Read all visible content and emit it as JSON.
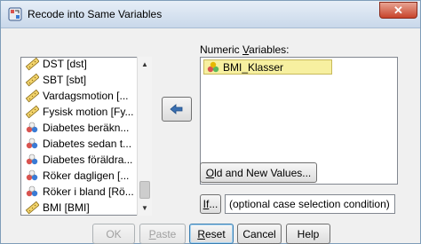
{
  "window": {
    "title": "Recode into Same Variables",
    "close_glyph": "✕"
  },
  "variable_list": {
    "items": [
      {
        "label": "DST [dst]",
        "icon": "scale-ruler-icon"
      },
      {
        "label": "SBT [sbt]",
        "icon": "scale-ruler-icon"
      },
      {
        "label": "Vardagsmotion [...",
        "icon": "scale-ruler-icon"
      },
      {
        "label": "Fysisk motion [Fy...",
        "icon": "scale-ruler-icon"
      },
      {
        "label": "Diabetes beräkn...",
        "icon": "nominal-circles-icon"
      },
      {
        "label": "Diabetes sedan t...",
        "icon": "nominal-circles-icon"
      },
      {
        "label": "Diabetes föräldra...",
        "icon": "nominal-circles-icon"
      },
      {
        "label": "Röker dagligen [...",
        "icon": "nominal-circles-icon"
      },
      {
        "label": "Röker i bland [Rö...",
        "icon": "nominal-circles-icon"
      },
      {
        "label": "BMI [BMI]",
        "icon": "scale-ruler-icon"
      }
    ]
  },
  "numeric_variables": {
    "label_prefix": "Numeric ",
    "label_mnemonic": "V",
    "label_suffix": "ariables:",
    "items": [
      {
        "label": "BMI_Klasser",
        "icon": "ordinal-bars-icon"
      }
    ]
  },
  "buttons": {
    "old_new_mnemonic": "O",
    "old_new_rest": "ld and New Values...",
    "if_mnemonic": "If",
    "if_rest": "...",
    "condition_text": "(optional case selection condition)",
    "ok": "OK",
    "paste_mnemonic": "P",
    "paste_rest": "aste",
    "reset_mnemonic": "R",
    "reset_rest": "eset",
    "cancel": "Cancel",
    "help": "Help"
  },
  "colors": {
    "selection_highlight": "#f7f0a0",
    "title_bar": "#c9d8ea",
    "close_button": "#c7432b"
  }
}
